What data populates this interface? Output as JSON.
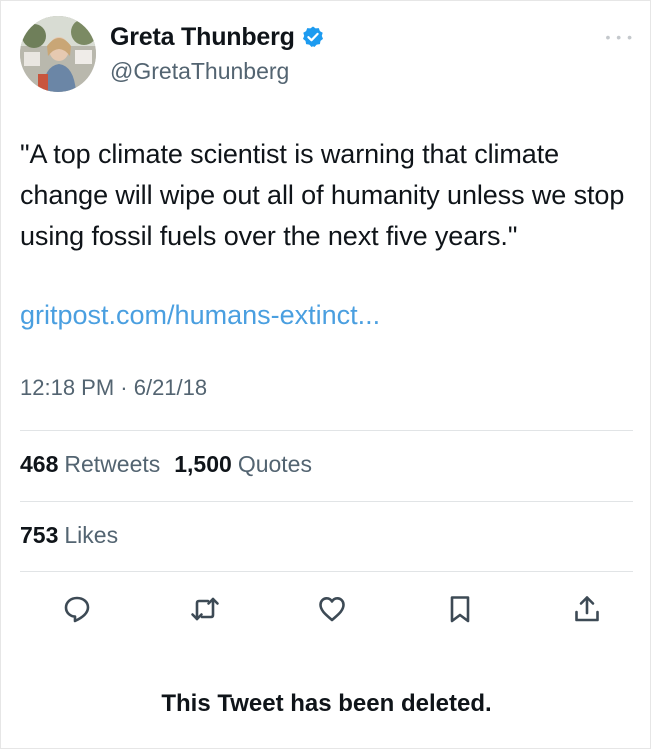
{
  "tweet": {
    "display_name": "Greta Thunberg",
    "handle": "@GretaThunberg",
    "text": "\"A top climate scientist is warning that climate change will wipe out all of humanity unless we stop using fossil fuels over the next five years.\"",
    "link": "gritpost.com/humans-extinct...",
    "timestamp": "12:18 PM · 6/21/18",
    "stats": {
      "retweets_count": "468",
      "retweets_label": "Retweets",
      "quotes_count": "1,500",
      "quotes_label": "Quotes",
      "likes_count": "753",
      "likes_label": "Likes"
    },
    "deleted_notice": "This Tweet has been deleted."
  },
  "icons": {
    "verified": "verified-badge-icon",
    "more": "more-options-icon",
    "reply": "reply-icon",
    "retweet": "retweet-icon",
    "like": "like-icon",
    "bookmark": "bookmark-icon",
    "share": "share-icon"
  },
  "colors": {
    "link": "#4a9fe0",
    "verified": "#1d9bf0",
    "secondary_text": "#536471",
    "primary_text": "#0f1419"
  }
}
